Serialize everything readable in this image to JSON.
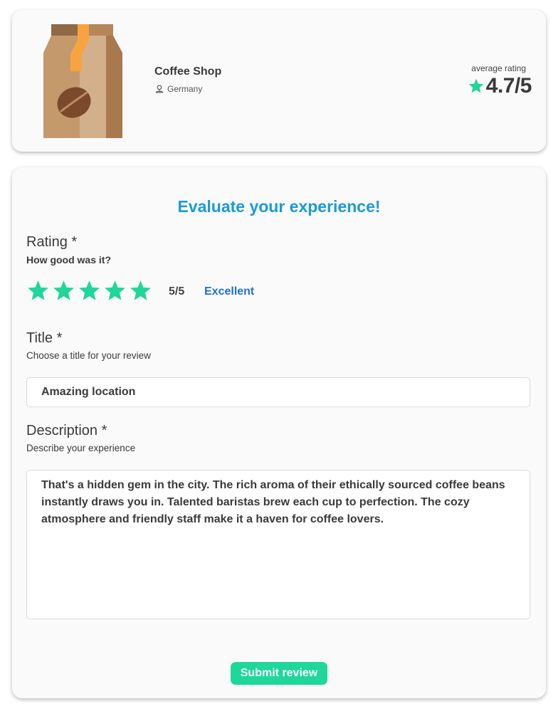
{
  "place": {
    "name": "Coffee Shop",
    "location": "Germany",
    "average_rating_label": "average rating",
    "average_rating_value": "4.7/5",
    "image_icon": "coffee-bag-icon"
  },
  "review": {
    "heading": "Evaluate your experience!",
    "rating": {
      "label": "Rating *",
      "sublabel": "How good was it?",
      "score": "5/5",
      "max": 5,
      "value": 5,
      "quality": "Excellent"
    },
    "title": {
      "label": "Title *",
      "sublabel": "Choose a title for your review",
      "value": "Amazing location"
    },
    "description": {
      "label": "Description *",
      "sublabel": "Describe your experience",
      "value": "That's a hidden gem in the city. The rich aroma of their ethically sourced coffee beans instantly draws you in. Talented baristas brew each cup to perfection. The cozy atmosphere and friendly staff make it a haven for coffee lovers."
    },
    "submit_label": "Submit review"
  },
  "colors": {
    "accent_green": "#1ed79a",
    "heading_blue": "#1a9bd7",
    "quality_blue": "#1f6fd6",
    "text": "#3a3a3a"
  }
}
